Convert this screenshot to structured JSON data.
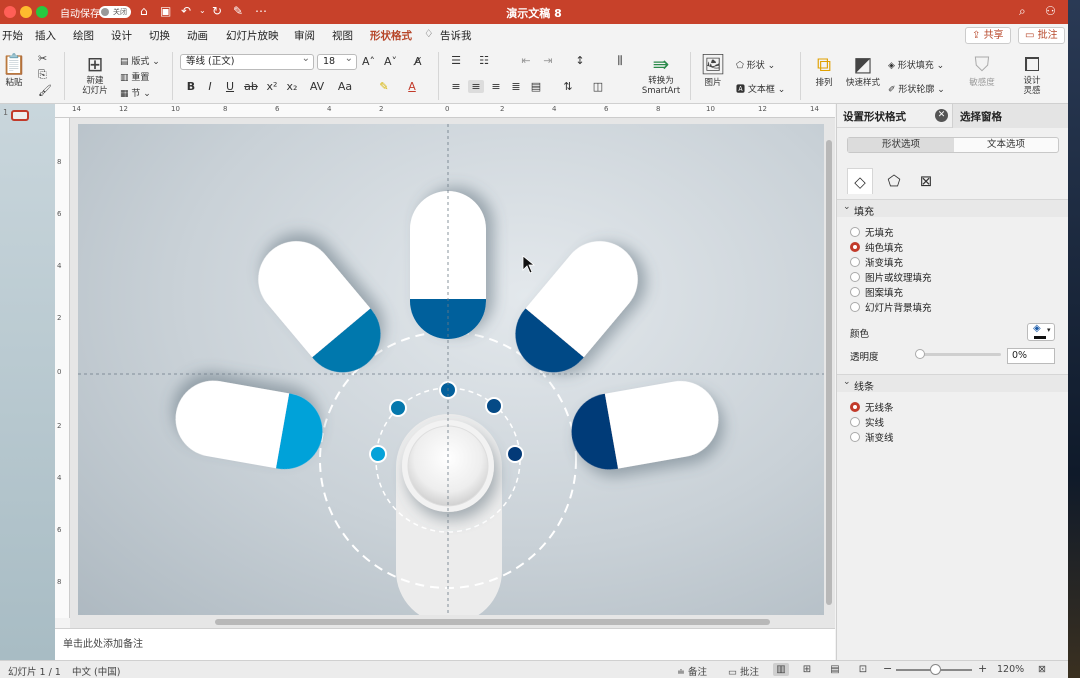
{
  "titlebar": {
    "autosave_label": "自动保存",
    "autosave_state": "关闭",
    "doc_title": "演示文稿 8"
  },
  "tabs": [
    "开始",
    "插入",
    "绘图",
    "设计",
    "切换",
    "动画",
    "幻灯片放映",
    "审阅",
    "视图",
    "形状格式",
    "告诉我"
  ],
  "active_tab": "形状格式",
  "share_label": "共享",
  "comments_label": "批注",
  "ribbon": {
    "paste": "粘贴",
    "new_slide": "新建\n幻灯片",
    "layout": "版式",
    "reset": "重置",
    "section": "节",
    "font_name": "等线 (正文)",
    "font_size": "18",
    "convert_smartart": "转换为\nSmartArt",
    "picture": "图片",
    "shapes": "形状",
    "textbox": "文本框",
    "arrange": "排列",
    "quick_styles": "快速样式",
    "shape_fill": "形状填充",
    "shape_outline": "形状轮廓",
    "sensitivity": "敏感度",
    "designer": "设计\n灵感"
  },
  "rulers": {
    "h": [
      "14",
      "12",
      "10",
      "8",
      "6",
      "4",
      "2",
      "0",
      "2",
      "4",
      "6",
      "8",
      "10",
      "12",
      "14"
    ],
    "v": [
      "8",
      "6",
      "4",
      "2",
      "0",
      "2",
      "4",
      "6",
      "8"
    ]
  },
  "notes_placeholder": "单击此处添加备注",
  "pane": {
    "title": "设置形状格式",
    "tab2": "选择窗格",
    "seg_shape": "形状选项",
    "seg_text": "文本选项",
    "fill_section": "填充",
    "fill_options": [
      "无填充",
      "纯色填充",
      "渐变填充",
      "图片或纹理填充",
      "图案填充",
      "幻灯片背景填充"
    ],
    "fill_selected": "纯色填充",
    "color_label": "颜色",
    "transparency_label": "透明度",
    "transparency_value": "0%",
    "transparency_level": 0,
    "line_section": "线条",
    "line_options": [
      "无线条",
      "实线",
      "渐变线"
    ],
    "line_selected": "无线条"
  },
  "status": {
    "slide_counter": "幻灯片 1 / 1",
    "language": "中文 (中国)",
    "notes_btn": "备注",
    "comments_btn": "批注",
    "zoom": "120%",
    "zoom_level": 0.45
  },
  "diagram_colors": {
    "c1": "#05a2d9",
    "c2": "#0578ad",
    "c3": "#03609c",
    "c4": "#054a86",
    "c5": "#033a78",
    "accent": "#c7412a"
  }
}
